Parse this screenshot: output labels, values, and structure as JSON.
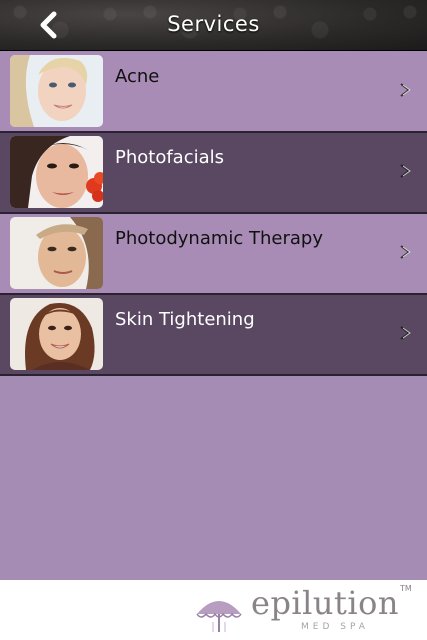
{
  "header": {
    "title": "Services"
  },
  "services": [
    {
      "label": "Acne"
    },
    {
      "label": "Photofacials"
    },
    {
      "label": "Photodynamic Therapy"
    },
    {
      "label": "Skin Tightening"
    }
  ],
  "footer": {
    "logo_text": "epilution",
    "logo_sub": "MED SPA",
    "logo_tm": "TM"
  }
}
